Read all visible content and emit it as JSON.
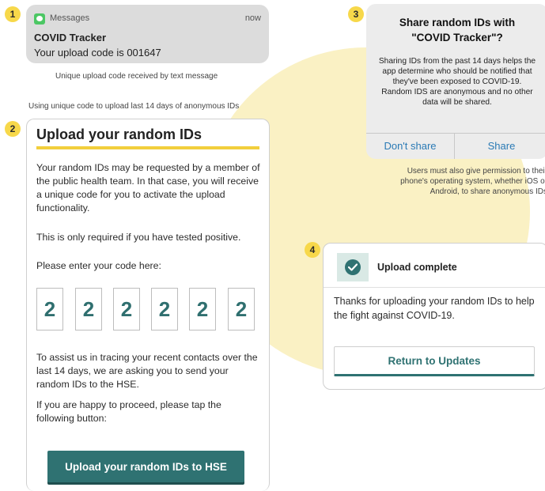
{
  "steps": [
    "1",
    "2",
    "3",
    "4"
  ],
  "notification": {
    "app": "Messages",
    "time": "now",
    "title": "COVID Tracker",
    "body": "Your upload code is 001647",
    "icon": "messages-icon",
    "caption": "Unique upload code received by text message"
  },
  "upload_caption": "Using unique code to upload last 14 days of anonymous IDs",
  "upload_card": {
    "title": "Upload your random IDs",
    "para1": "Your random IDs may be requested by a member of the public health team. In that case, you will receive a unique code for you to activate the upload functionality.",
    "para2": "This is only required if you have tested positive.",
    "prompt": "Please enter your code here:",
    "code": [
      "2",
      "2",
      "2",
      "2",
      "2",
      "2"
    ],
    "para3": "To assist us in tracing your recent contacts over the last 14 days, we are asking you to send your random IDs to the HSE.",
    "para4": "If you are happy to proceed, please tap the following button:",
    "button": "Upload your random IDs to HSE"
  },
  "share_dialog": {
    "title_line1": "Share random IDs with",
    "title_line2": "\"COVID Tracker\"?",
    "body": "Sharing IDs from the past 14 days helps the app determine who should be notified that they've been exposed to COVID-19. Random IDS are anonymous and no other data will be shared.",
    "cancel": "Don't share",
    "confirm": "Share",
    "note_line1": "Users must also give permission to their",
    "note_line2": "phone's operating system, whether iOS or",
    "note_line3": "Android, to share anonymous IDs"
  },
  "complete_card": {
    "icon": "check-circle-icon",
    "title": "Upload complete",
    "text": "Thanks for uploading your random IDs to help the fight against COVID-19.",
    "button": "Return to Updates"
  },
  "colors": {
    "accent": "#2f7272",
    "highlight": "#f2cf3c",
    "background_circle": "#faf1c4",
    "ios_blue": "#2a7ab5"
  }
}
